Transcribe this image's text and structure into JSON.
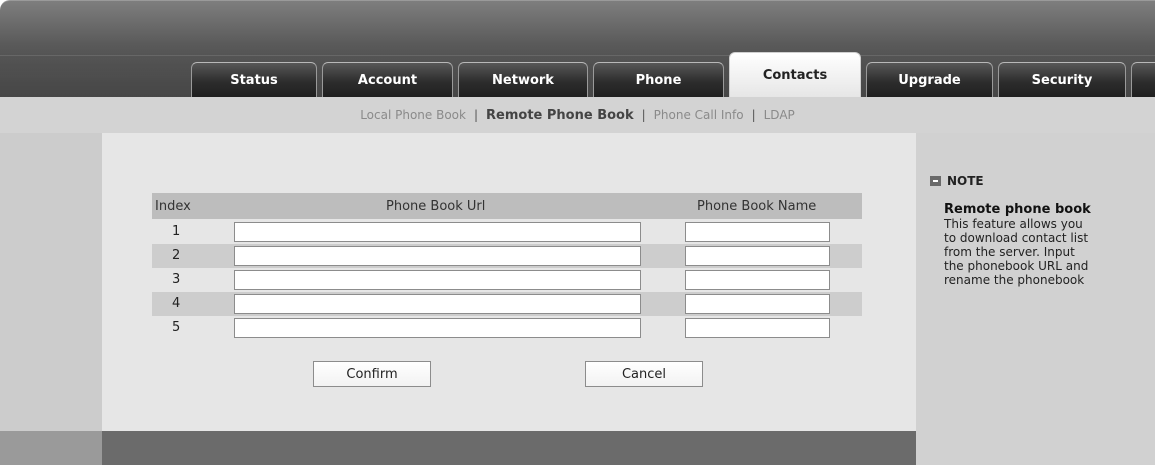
{
  "tabs": [
    {
      "label": "Status",
      "active": false
    },
    {
      "label": "Account",
      "active": false
    },
    {
      "label": "Network",
      "active": false
    },
    {
      "label": "Phone",
      "active": false
    },
    {
      "label": "Contacts",
      "active": true
    },
    {
      "label": "Upgrade",
      "active": false
    },
    {
      "label": "Security",
      "active": false
    }
  ],
  "subnav": {
    "items": [
      {
        "label": "Local Phone Book",
        "active": false
      },
      {
        "label": "Remote Phone Book",
        "active": true
      },
      {
        "label": "Phone Call Info",
        "active": false
      },
      {
        "label": "LDAP",
        "active": false
      }
    ],
    "separator": "|"
  },
  "table": {
    "headers": {
      "index": "Index",
      "url": "Phone Book Url",
      "name": "Phone Book Name"
    },
    "rows": [
      {
        "index": "1",
        "url": "",
        "name": ""
      },
      {
        "index": "2",
        "url": "",
        "name": ""
      },
      {
        "index": "3",
        "url": "",
        "name": ""
      },
      {
        "index": "4",
        "url": "",
        "name": ""
      },
      {
        "index": "5",
        "url": "",
        "name": ""
      }
    ]
  },
  "buttons": {
    "confirm": "Confirm",
    "cancel": "Cancel"
  },
  "note": {
    "title": "NOTE",
    "heading": "Remote phone book",
    "lines": [
      "This feature allows you",
      "to download contact list",
      "from the server. Input",
      "the phonebook URL and",
      "rename the phonebook"
    ]
  }
}
